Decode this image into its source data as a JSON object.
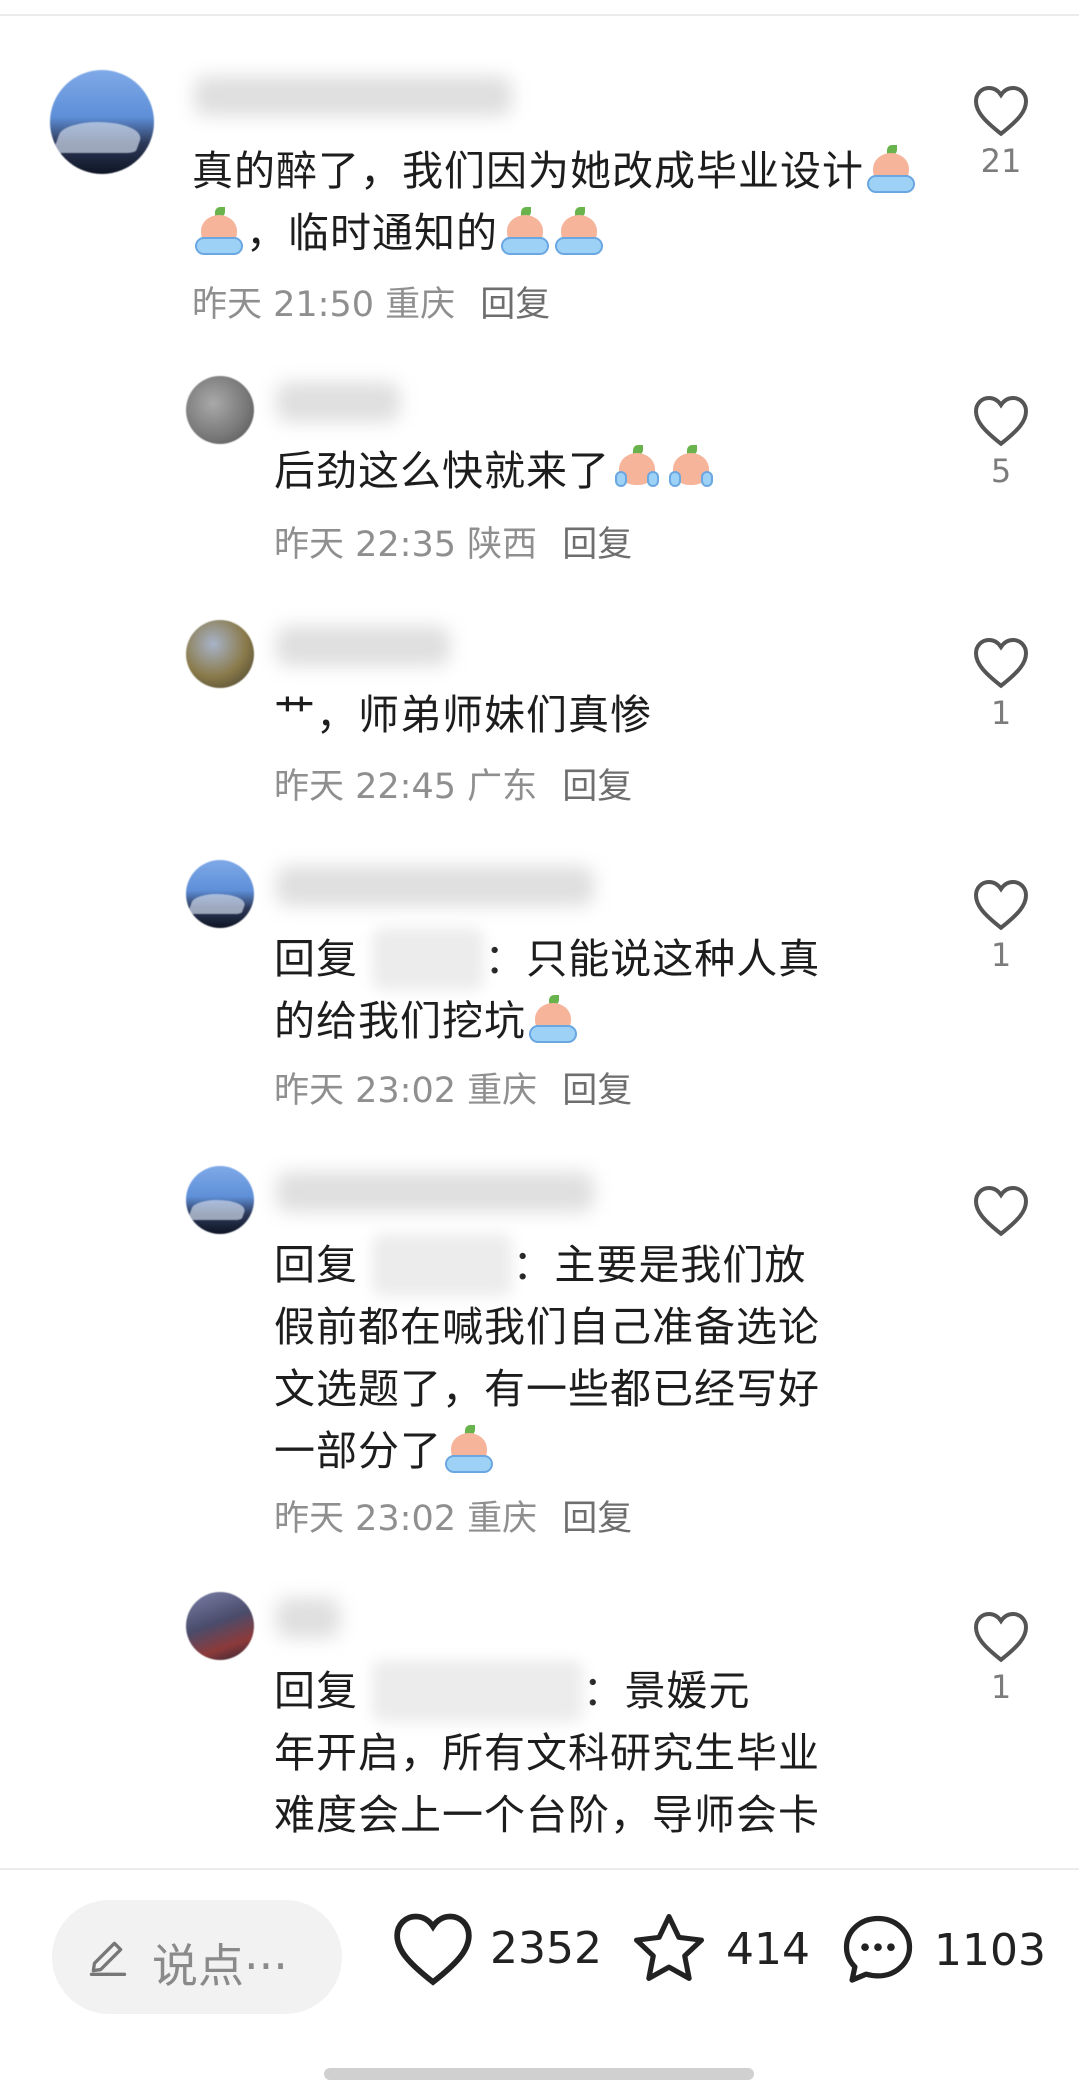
{
  "comments": [
    {
      "text": "真的醉了，我们因为她改成毕业设计",
      "text2": "，临时通知的",
      "meta_time": "昨天 21:50",
      "meta_location": "重庆",
      "reply_label": "回复",
      "likes": "21"
    },
    {
      "text": "后劲这么快就来了",
      "meta_time": "昨天 22:35",
      "meta_location": "陕西",
      "reply_label": "回复",
      "likes": "5"
    },
    {
      "text": "艹，师弟师妹们真惨",
      "meta_time": "昨天 22:45",
      "meta_location": "广东",
      "reply_label": "回复",
      "likes": "1"
    },
    {
      "reply_prefix": "回复",
      "text_tail": "：只能说这种人真",
      "text_line2": "的给我们挖坑",
      "meta_time": "昨天 23:02",
      "meta_location": "重庆",
      "reply_label": "回复",
      "likes": "1"
    },
    {
      "reply_prefix": "回复",
      "text_tail": "：主要是我们放",
      "text_line2": "假前都在喊我们自己准备选论",
      "text_line3": "文选题了，有一些都已经写好",
      "text_line4": "一部分了",
      "meta_time": "昨天 23:02",
      "meta_location": "重庆",
      "reply_label": "回复",
      "likes": ""
    },
    {
      "reply_prefix": "回复",
      "text_tail": "：景媛元",
      "text_line2": "年开启，所有文科研究生毕业",
      "text_line3": "难度会上一个台阶，导师会卡",
      "likes": "1"
    }
  ],
  "bottom_bar": {
    "input_placeholder": "说点···",
    "likes": "2352",
    "favorites": "414",
    "comments": "1103"
  },
  "icons": {
    "like": "heart-icon",
    "favorite": "star-icon",
    "comment": "chat-bubble-icon",
    "compose": "pencil-icon"
  }
}
